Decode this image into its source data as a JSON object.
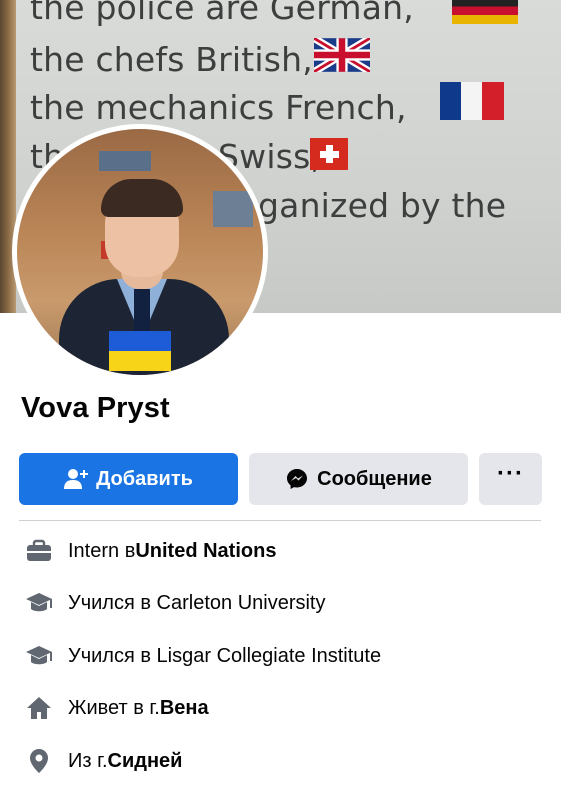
{
  "cover": {
    "lines": [
      "the police are German,",
      "the chefs British,",
      "the mechanics French,",
      "the",
      "Swiss,",
      "ganized by the"
    ]
  },
  "profile": {
    "name": "Vova Pryst"
  },
  "actions": {
    "add_label": "Добавить",
    "message_label": "Сообщение",
    "more_label": "···"
  },
  "colors": {
    "primary": "#1b74e4",
    "secondary_button": "#e4e6eb",
    "icon": "#606770"
  },
  "intro": [
    {
      "icon": "briefcase-icon",
      "prefix": "Intern в ",
      "value": "United Nations"
    },
    {
      "icon": "graduation-cap-icon",
      "prefix": "Учился в Carleton University",
      "value": ""
    },
    {
      "icon": "graduation-cap-icon",
      "prefix": "Учился в Lisgar Collegiate Institute",
      "value": ""
    },
    {
      "icon": "home-icon",
      "prefix": "Живет в г. ",
      "value": "Вена"
    },
    {
      "icon": "location-pin-icon",
      "prefix": "Из г. ",
      "value": "Сидней"
    }
  ]
}
